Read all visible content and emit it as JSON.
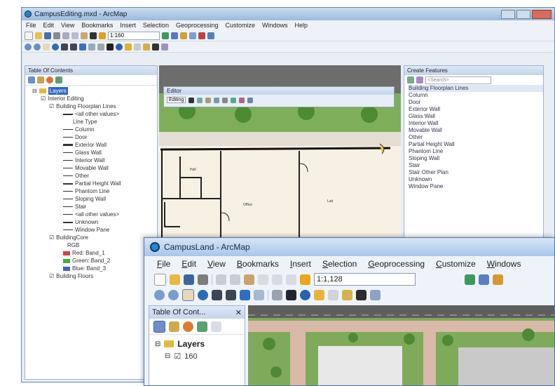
{
  "back_window": {
    "title": "CampusEditing.mxd - ArcMap",
    "menu": [
      "File",
      "Edit",
      "View",
      "Bookmarks",
      "Insert",
      "Selection",
      "Geoprocessing",
      "Customize",
      "Windows",
      "Help"
    ],
    "scale": "1:160",
    "toc": {
      "title": "Table Of Contents",
      "items": [
        "Layers",
        "Interior Editing",
        "Building Floorplan Lines",
        "<all other values>",
        "Line Type",
        "Column",
        "Door",
        "Exterior Wall",
        "Glass Wall",
        "Interior Wall",
        "Movable Wall",
        "Other",
        "Partial Height Wall",
        "Phantom Line",
        "Sloping Wall",
        "Stair",
        "<all other values>",
        "Unknown",
        "Window Pane",
        "BuildingCore",
        "RGB",
        "Red: Band_1",
        "Green: Band_2",
        "Blue: Band_3",
        "Building Floors"
      ]
    },
    "editor": {
      "title": "Editor",
      "label": "Editing"
    },
    "create_features": {
      "title": "Create Features",
      "search": "<Search>",
      "items": [
        "Building Floorplan Lines",
        "Column",
        "Door",
        "Exterior Wall",
        "Glass Wall",
        "Interior Wall",
        "Movable Wall",
        "Other",
        "Partial Height Wall",
        "Phantom Line",
        "Sloping Wall",
        "Stair",
        "Stair Other Plan",
        "Unknown",
        "Window Pane"
      ]
    },
    "map_labels": [
      "Hall",
      "Office",
      "Lab"
    ]
  },
  "front_window": {
    "title": "CampusLand - ArcMap",
    "menu": [
      "File",
      "Edit",
      "View",
      "Bookmarks",
      "Insert",
      "Selection",
      "Geoprocessing",
      "Customize",
      "Windows"
    ],
    "scale": "1:1,128",
    "toc": {
      "title": "Table Of Cont...",
      "layers_label": "Layers",
      "sublayer": "160"
    }
  },
  "colors": {
    "title_blue": "#a9c6e8",
    "map_grass": "#7fae5a",
    "map_path": "#d9b9a8",
    "red_band": "#d04040",
    "green_band": "#40b040",
    "blue_band": "#4060d0"
  }
}
